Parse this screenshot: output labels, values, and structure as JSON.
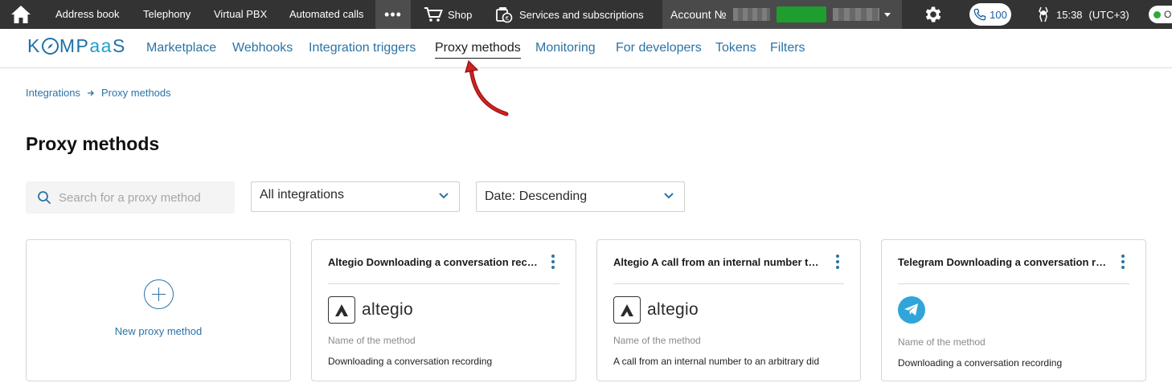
{
  "topbar": {
    "links": {
      "address_book": "Address book",
      "telephony": "Telephony",
      "virtual_pbx": "Virtual PBX",
      "automated_calls": "Automated calls"
    },
    "more": "•••",
    "shop": "Shop",
    "services": "Services and subscriptions",
    "account_label": "Account №",
    "calls_count": "100",
    "time": "15:38",
    "timezone": "(UTC+3)",
    "status_label": "O"
  },
  "logo": {
    "part1": "K",
    "part2": "MP",
    "part3": "aa",
    "part4": "S"
  },
  "subnav": {
    "marketplace": "Marketplace",
    "webhooks": "Webhooks",
    "integration_triggers": "Integration triggers",
    "proxy_methods": "Proxy methods",
    "monitoring": "Monitoring",
    "for_developers": "For developers",
    "tokens": "Tokens",
    "filters": "Filters"
  },
  "breadcrumb": {
    "root": "Integrations",
    "current": "Proxy methods"
  },
  "page_title": "Proxy methods",
  "filters": {
    "search_placeholder": "Search for a proxy method",
    "integration_value": "All integrations",
    "sort_value": "Date: Descending"
  },
  "new_card": {
    "label": "New proxy method"
  },
  "cards": [
    {
      "title": "Altegio Downloading a conversation recording",
      "brand": "altegio",
      "field_label": "Name of the method",
      "field_value": "Downloading a conversation recording"
    },
    {
      "title": "Altegio A call from an internal number to an arbitrary did",
      "brand": "altegio",
      "field_label": "Name of the method",
      "field_value": "A call from an internal number to an arbitrary did"
    },
    {
      "title": "Telegram Downloading a conversation recording",
      "brand": "telegram",
      "field_label": "Name of the method",
      "field_value": "Downloading a conversation recording"
    }
  ],
  "colors": {
    "topbar_bg": "#333333",
    "link_blue": "#2b73a5",
    "account_highlight": "#1f9d2e",
    "telegram_blue": "#31a5d8",
    "annotation_arrow": "#d32020"
  }
}
